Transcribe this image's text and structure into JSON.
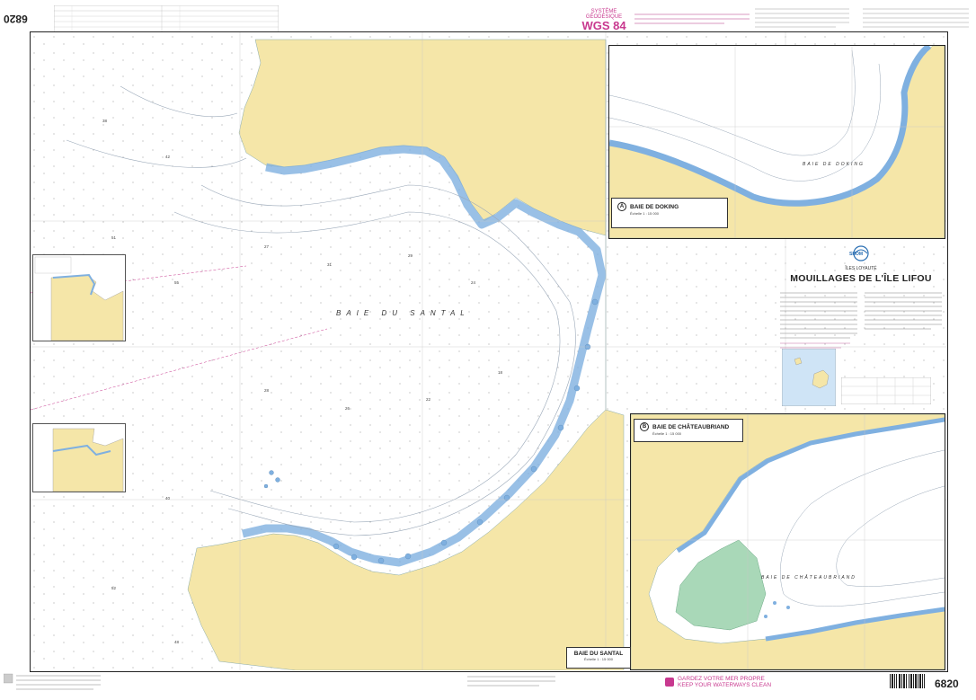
{
  "chart_number": "6820",
  "chart_number_rotated": "6820",
  "geodesy": {
    "system_label": "SYSTÈME GÉODÉSIQUE",
    "datum": "WGS 84"
  },
  "title_block": {
    "region": "ÎLES LOYAUTÉ",
    "title": "MOUILLAGES DE L'ÎLE LIFOU",
    "logo": "SHOM"
  },
  "main_chart": {
    "bay_label": "BAIE DU SANTAL",
    "cartouche_title": "BAIE DU SANTAL",
    "cartouche_scale": "Échelle 1 : 15 000"
  },
  "inset_a": {
    "marker": "A",
    "title": "BAIE DE DOKING",
    "scale": "Échelle 1 : 15 000",
    "bay_label": "BAIE DE DOKING"
  },
  "inset_b": {
    "marker": "B",
    "title": "BAIE DE CHÂTEAUBRIAND",
    "scale": "Échelle 1 : 15 000",
    "bay_label": "BAIE DE CHÂTEAUBRIAND"
  },
  "footer": {
    "slogan_line1": "GARDEZ VOTRE MER PROPRE",
    "slogan_line2": "KEEP YOUR WATERWAYS CLEAN",
    "chart_number": "6820"
  },
  "colors": {
    "land": "#f5e6a8",
    "land_dark": "#efd98a",
    "shallow_water": "#b8d4ef",
    "drying": "#a9d8b8",
    "deep_water": "#ffffff",
    "magenta": "#c8398f",
    "frame": "#222222"
  }
}
